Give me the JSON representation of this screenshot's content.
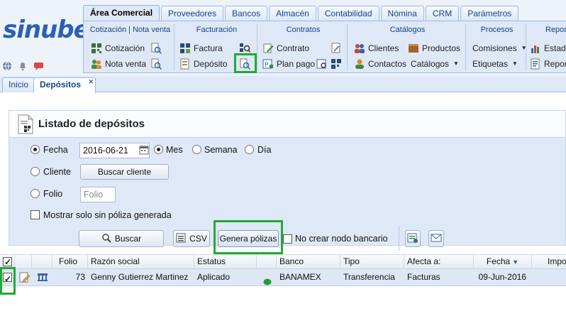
{
  "app": {
    "logo_text": "sinube"
  },
  "top_tabs": [
    "Área Comercial",
    "Proveedores",
    "Bancos",
    "Almacén",
    "Contabilidad",
    "Nómina",
    "CRM",
    "Parámetros"
  ],
  "ribbon": {
    "groups": {
      "cotizacion": {
        "title": "Cotización | Nota venta",
        "item1": "Cotización",
        "item2": "Nota venta"
      },
      "facturacion": {
        "title": "Facturación",
        "item1": "Factura",
        "item2": "Depósito"
      },
      "contratos": {
        "title": "Contratos",
        "item1": "Contrato",
        "item2": "Plan pago"
      },
      "catalogos": {
        "title": "Catálogos",
        "item1": "Clientes",
        "item2": "Productos",
        "item3": "Contactos",
        "item4": "Catálogos"
      },
      "procesos": {
        "title": "Procesos",
        "item1": "Comisiones",
        "item2": "Etiquetas"
      },
      "reportes": {
        "title": "Repor",
        "item1": "Estad",
        "item2": "Repor"
      }
    }
  },
  "page_tabs": {
    "home": "Inicio",
    "active": "Depósitos",
    "close_symbol": "✕"
  },
  "panel": {
    "title": "Listado de depósitos"
  },
  "filters": {
    "fecha_label": "Fecha",
    "fecha_value": "2016-06-21",
    "mes_label": "Mes",
    "semana_label": "Semana",
    "dia_label": "Día",
    "cliente_label": "Cliente",
    "buscar_cliente_label": "Buscar cliente",
    "folio_label": "Folio",
    "folio_placeholder": "Folio",
    "sin_poliza_label": "Mostrar solo sin póliza generada"
  },
  "toolbar": {
    "buscar_label": "Buscar",
    "csv_label": "CSV",
    "genera_polizas_label": "Genera pólizas",
    "no_nodo_label": "No crear nodo bancario"
  },
  "grid": {
    "columns": [
      "Folio",
      "Razón social",
      "Estatus",
      "Banco",
      "Tipo",
      "Afecta a:",
      "Fecha",
      "Impor"
    ],
    "rows": [
      {
        "folio": "73",
        "razon_social": "Genny Gutierrez Martinez",
        "estatus": "Aplicado",
        "banco": "BANAMEX",
        "tipo": "Transferencia",
        "afecta_a": "Facturas",
        "fecha": "09-Jun-2016",
        "status_color": "#2e9a3e"
      }
    ]
  },
  "colors": {
    "highlight": "#22aa33",
    "brand": "#2a61b5"
  }
}
